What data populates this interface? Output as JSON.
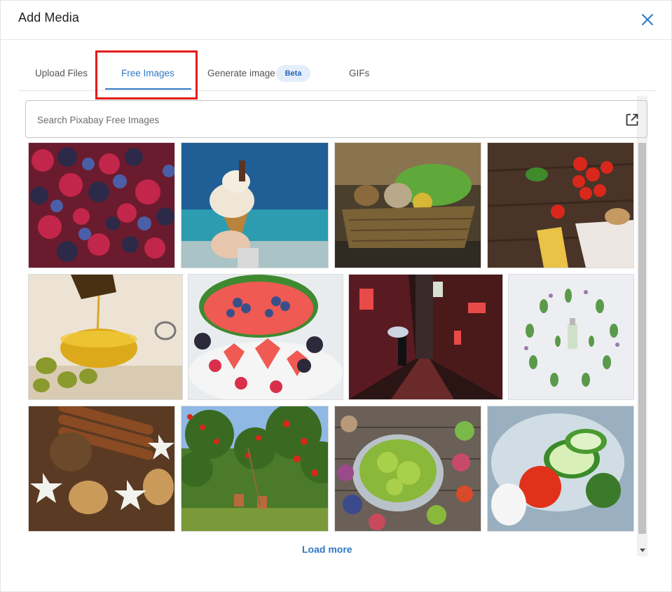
{
  "dialog": {
    "title": "Add Media",
    "close_icon": "close-icon"
  },
  "tabs": [
    {
      "label": "Upload Files"
    },
    {
      "label": "Free Images"
    },
    {
      "label": "Generate image"
    },
    {
      "label": "GIFs"
    }
  ],
  "tabs_active_index": 1,
  "badge": "Beta",
  "search": {
    "placeholder": "Search Pixabay Free Images",
    "value": "",
    "open_external_icon": "external-link-icon"
  },
  "images": [
    {
      "name": "berries"
    },
    {
      "name": "ice-cream-cone"
    },
    {
      "name": "vegetable-basket"
    },
    {
      "name": "tomatoes-pasta"
    },
    {
      "name": "olive-oil"
    },
    {
      "name": "watermelon-hearts"
    },
    {
      "name": "night-alley"
    },
    {
      "name": "herbs-bottle"
    },
    {
      "name": "cinnamon-nuts"
    },
    {
      "name": "apple-orchard"
    },
    {
      "name": "salad-table"
    },
    {
      "name": "vegetables-splash"
    }
  ],
  "load_more": "Load more",
  "colors": {
    "accent": "#2f78c4",
    "highlight": "#e31b1b",
    "badge_bg": "#e3eefa"
  }
}
